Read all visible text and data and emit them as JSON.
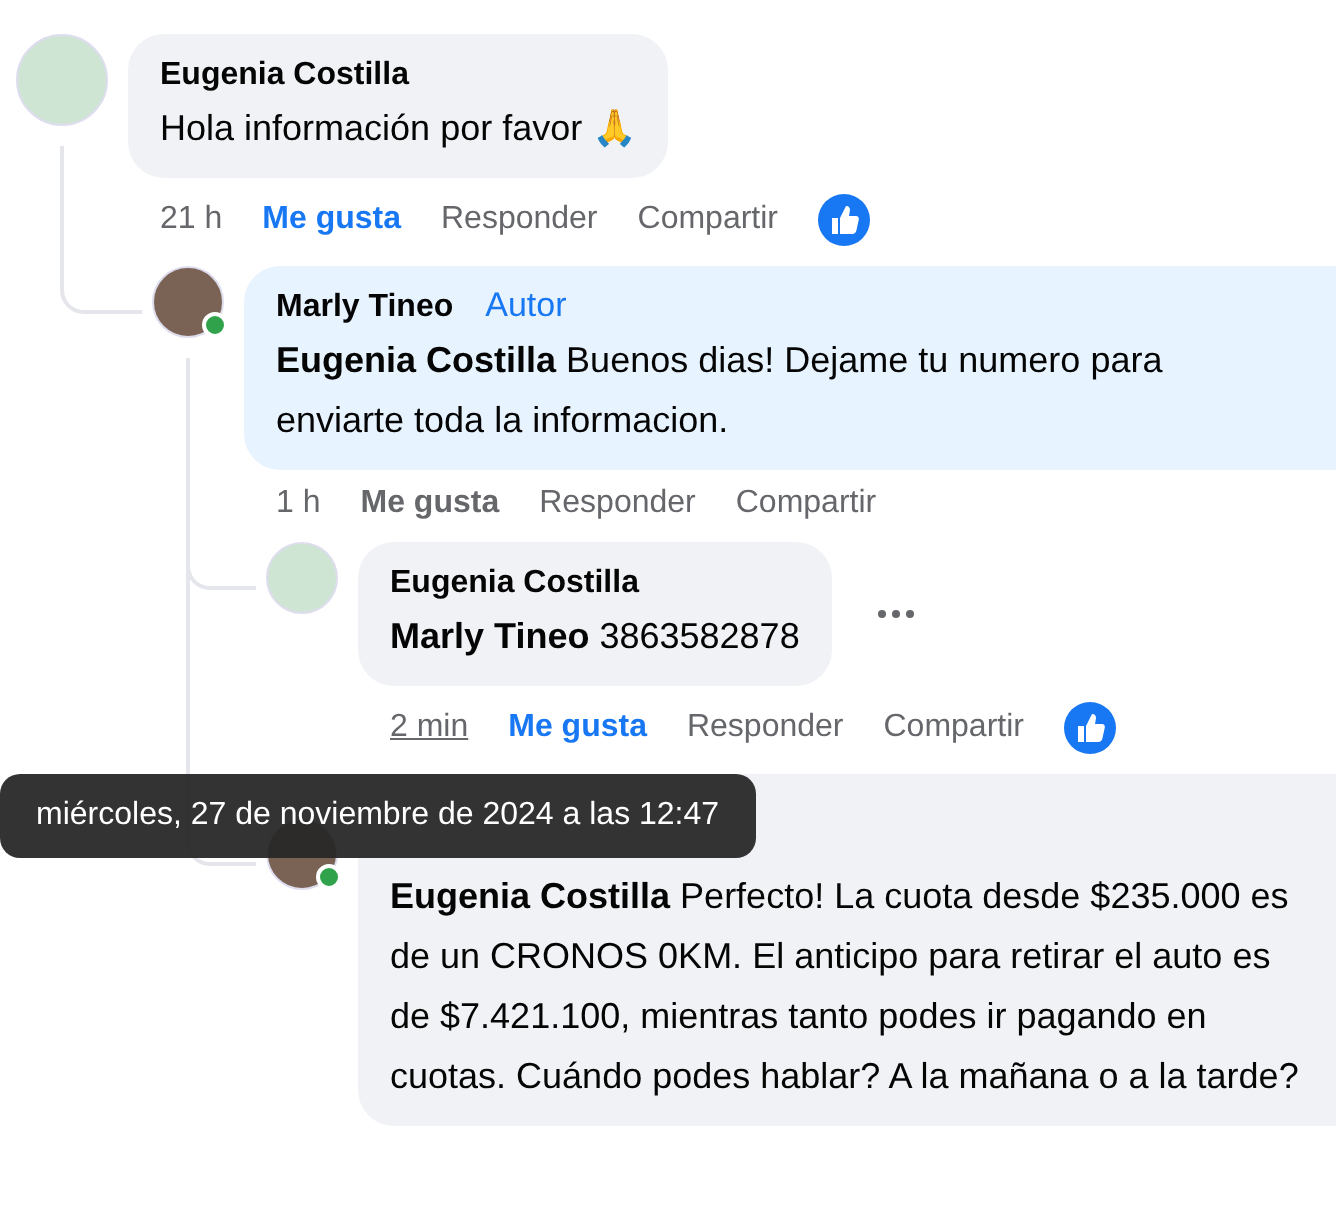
{
  "comments": [
    {
      "author": "Eugenia Costilla",
      "color": "#cfe5d4",
      "online": false,
      "text": "Hola información por favor 🙏",
      "highlighted": false,
      "actions": {
        "time": "21 h",
        "time_hovered": false,
        "like": "Me gusta",
        "liked": true,
        "reply": "Responder",
        "share": "Compartir",
        "like_reaction": true
      },
      "menu_shown": false,
      "children": [
        {
          "author": "Marly Tineo",
          "badge": "Autor",
          "color": "#7a6255",
          "online": true,
          "mention": "Eugenia Costilla",
          "text": "Buenos dias! Dejame tu numero para enviarte toda la informacion.",
          "highlighted": true,
          "actions": {
            "time": "1 h",
            "time_hovered": false,
            "like": "Me gusta",
            "liked": false,
            "reply": "Responder",
            "share": "Compartir",
            "like_reaction": false
          },
          "menu_shown": false,
          "children": [
            {
              "author": "Eugenia Costilla",
              "color": "#cfe5d4",
              "online": false,
              "mention": "Marly Tineo",
              "text": "3863582878",
              "highlighted": false,
              "actions": {
                "time": "2 min",
                "time_hovered": true,
                "tooltip": "miércoles, 27 de noviembre de 2024 a las 12:47",
                "like": "Me gusta",
                "liked": true,
                "reply": "Responder",
                "share": "Compartir",
                "like_reaction": true
              },
              "menu_shown": true
            },
            {
              "color": "#7a6255",
              "online": true,
              "mention": "Eugenia Costilla",
              "text": "Perfecto! La cuota desde $235.000 es de un CRONOS 0KM. El anticipo para retirar el auto es de $7.421.100, mientras tanto podes ir pagando en cuotas. Cuándo podes hablar? A la mañana o a la tarde?",
              "highlighted": false,
              "menu_shown": false
            }
          ]
        }
      ]
    }
  ]
}
